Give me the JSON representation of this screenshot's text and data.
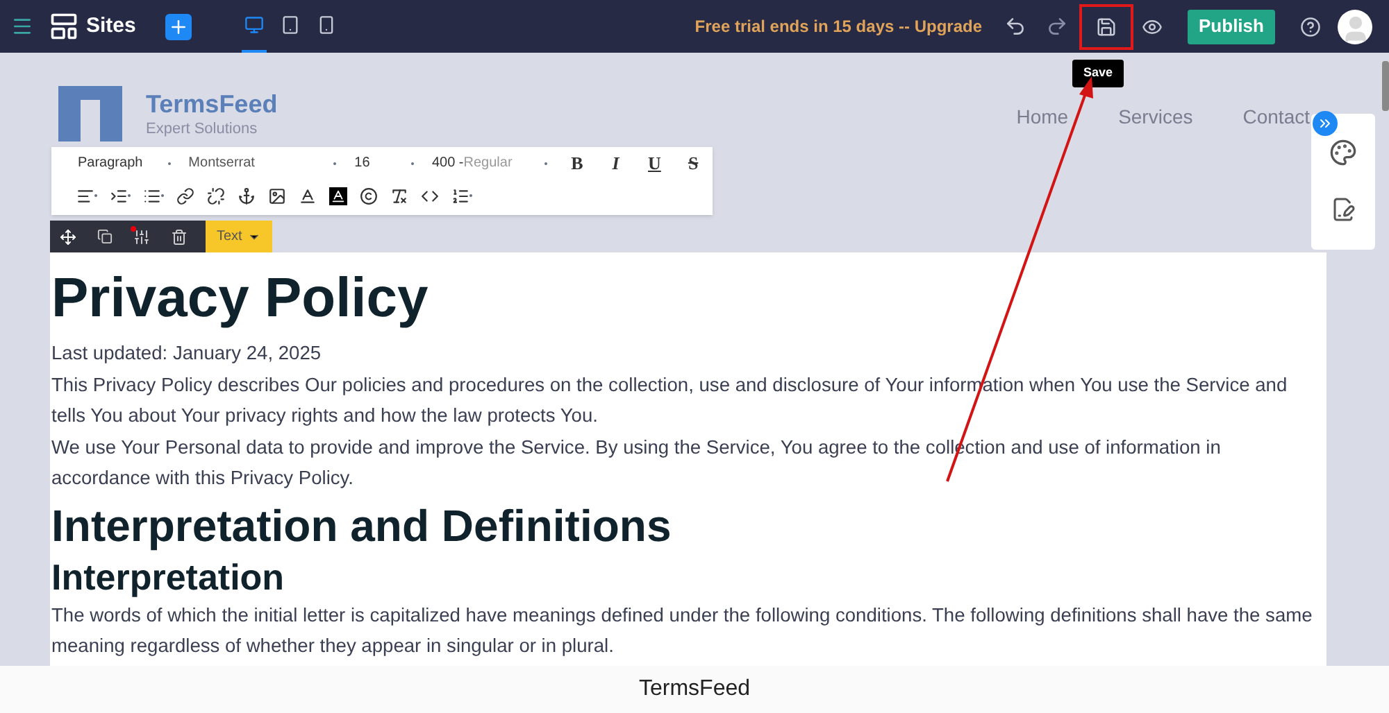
{
  "topbar": {
    "brand": "Sites",
    "devices": [
      {
        "kind": "desktop",
        "selected": true
      },
      {
        "kind": "tablet",
        "selected": false
      },
      {
        "kind": "phone",
        "selected": false
      }
    ],
    "trial": "Free trial ends in 15 days -- Upgrade",
    "publish": "Publish",
    "tooltip": "Save"
  },
  "header": {
    "logo_title": "TermsFeed",
    "logo_subtitle": "Expert Solutions",
    "nav": [
      "Home",
      "Services",
      "Contact"
    ]
  },
  "editor_toolbar": {
    "block": "Paragraph",
    "font": "Montserrat",
    "size": "16",
    "weight_number": "400 -",
    "weight_name": "Regular",
    "format_buttons": [
      {
        "kind": "bold",
        "label": "B"
      },
      {
        "kind": "italic",
        "label": "I"
      },
      {
        "kind": "underline",
        "label": "U"
      },
      {
        "kind": "strike",
        "label": "S"
      }
    ]
  },
  "element_toolbar": {
    "type": "Text"
  },
  "content": [
    {
      "kind": "h1",
      "text": "Privacy Policy"
    },
    {
      "kind": "p",
      "text": "Last updated: January 24, 2025"
    },
    {
      "kind": "p",
      "text": "This Privacy Policy describes Our policies and procedures on the collection, use and disclosure of Your information when You use the Service and tells You about Your privacy rights and how the law protects You."
    },
    {
      "kind": "p",
      "text": "We use Your Personal data to provide and improve the Service. By using the Service, You agree to the collection and use of information in accordance with this Privacy Policy."
    },
    {
      "kind": "h2",
      "text": "Interpretation and Definitions"
    },
    {
      "kind": "h3",
      "text": "Interpretation"
    },
    {
      "kind": "p",
      "text": "The words of which the initial letter is capitalized have meanings defined under the following conditions. The following definitions shall have the same meaning regardless of whether they appear in singular or in plural."
    }
  ],
  "caption": "TermsFeed"
}
